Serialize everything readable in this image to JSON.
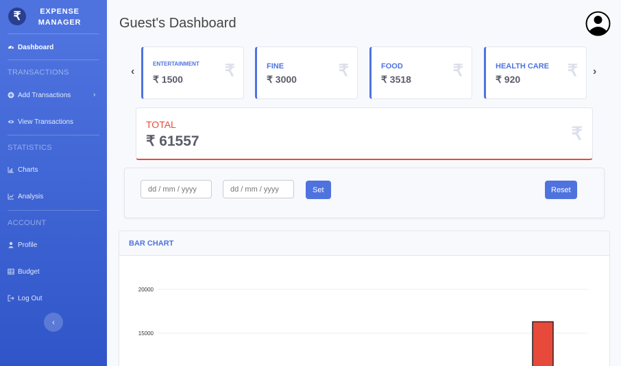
{
  "sidebar": {
    "brand_logo": "₹",
    "brand_line1": "EXPENSE",
    "brand_line2": "MANAGER",
    "dashboard": "Dashboard",
    "heading_transactions": "TRANSACTIONS",
    "add_transactions": "Add Transactions",
    "view_transactions": "View Transactions",
    "heading_statistics": "STATISTICS",
    "charts": "Charts",
    "analysis": "Analysis",
    "heading_account": "ACCOUNT",
    "profile": "Profile",
    "budget": "Budget",
    "logout": "Log Out",
    "arrow_right": "›",
    "toggle_icon": "‹"
  },
  "header": {
    "title": "Guest's Dashboard"
  },
  "carousel": {
    "prev": "‹",
    "next": "›"
  },
  "cards": [
    {
      "category": "ENTERTAINMENT",
      "amount": "₹ 1500",
      "icon": "₹"
    },
    {
      "category": "FINE",
      "amount": "₹ 3000",
      "icon": "₹"
    },
    {
      "category": "FOOD",
      "amount": "₹ 3518",
      "icon": "₹"
    },
    {
      "category": "HEALTH CARE",
      "amount": "₹ 920",
      "icon": "₹"
    }
  ],
  "total": {
    "label": "TOTAL",
    "amount": "₹ 61557",
    "icon": "₹"
  },
  "filter": {
    "from_placeholder": "dd / mm / yyyy",
    "to_placeholder": "dd / mm / yyyy",
    "set_label": "Set",
    "reset_label": "Reset"
  },
  "colors": {
    "primary": "#4e73df",
    "danger": "#e74a3b"
  },
  "chart_data": {
    "type": "bar",
    "title": "BAR CHART",
    "y_ticks": [
      "20000",
      "15000"
    ],
    "ylim": [
      0,
      20000
    ],
    "grid": true,
    "series": [
      {
        "values": [
          16300
        ]
      }
    ]
  }
}
